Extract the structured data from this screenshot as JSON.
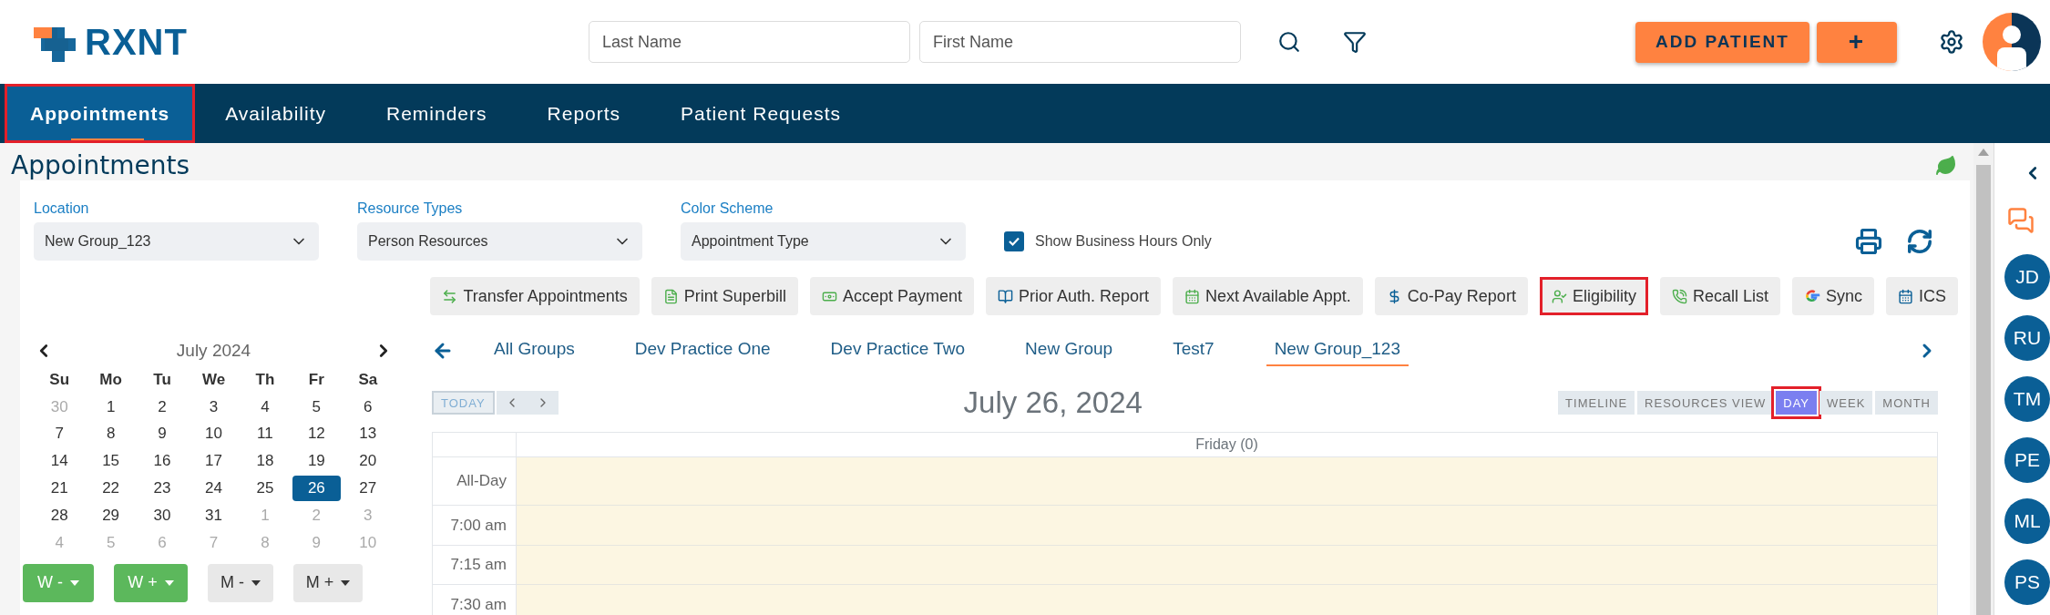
{
  "header": {
    "logo": "RXNT",
    "search_fields": [
      {
        "placeholder": "Last Name"
      },
      {
        "placeholder": "First Name"
      }
    ],
    "add_patient": "ADD PATIENT",
    "add_button": "+"
  },
  "nav": {
    "tabs": [
      {
        "label": "Appointments",
        "selected": true,
        "highlighted": true
      },
      {
        "label": "Availability",
        "selected": false,
        "highlighted": false
      },
      {
        "label": "Reminders",
        "selected": false,
        "highlighted": false
      },
      {
        "label": "Reports",
        "selected": false,
        "highlighted": false
      },
      {
        "label": "Patient Requests",
        "selected": false,
        "highlighted": false
      }
    ]
  },
  "page_title": "Appointments",
  "filters": [
    {
      "label": "Location",
      "value": "New Group_123"
    },
    {
      "label": "Resource Types",
      "value": "Person Resources"
    },
    {
      "label": "Color Scheme",
      "value": "Appointment Type"
    }
  ],
  "business_hours": {
    "label": "Show Business Hours Only",
    "checked": true
  },
  "actions": [
    {
      "kind": "transfer",
      "label": "Transfer Appointments",
      "highlighted": false
    },
    {
      "kind": "superbill",
      "label": "Print Superbill",
      "highlighted": false
    },
    {
      "kind": "payment",
      "label": "Accept Payment",
      "highlighted": false
    },
    {
      "kind": "auth",
      "label": "Prior Auth. Report",
      "highlighted": false
    },
    {
      "kind": "next",
      "label": "Next Available Appt.",
      "highlighted": false
    },
    {
      "kind": "copay",
      "label": "Co-Pay Report",
      "highlighted": false
    },
    {
      "kind": "eligibility",
      "label": "Eligibility",
      "highlighted": true
    },
    {
      "kind": "recall",
      "label": "Recall List",
      "highlighted": false
    },
    {
      "kind": "sync",
      "label": "Sync",
      "highlighted": false
    },
    {
      "kind": "ics",
      "label": "ICS",
      "highlighted": false
    }
  ],
  "mini_calendar": {
    "month": "July 2024",
    "weekdays": [
      "Su",
      "Mo",
      "Tu",
      "We",
      "Th",
      "Fr",
      "Sa"
    ],
    "weeks": [
      [
        {
          "day": "30",
          "outside": true,
          "selected": false
        },
        {
          "day": "1",
          "outside": false,
          "selected": false
        },
        {
          "day": "2",
          "outside": false,
          "selected": false
        },
        {
          "day": "3",
          "outside": false,
          "selected": false
        },
        {
          "day": "4",
          "outside": false,
          "selected": false
        },
        {
          "day": "5",
          "outside": false,
          "selected": false
        },
        {
          "day": "6",
          "outside": false,
          "selected": false
        }
      ],
      [
        {
          "day": "7",
          "outside": false,
          "selected": false
        },
        {
          "day": "8",
          "outside": false,
          "selected": false
        },
        {
          "day": "9",
          "outside": false,
          "selected": false
        },
        {
          "day": "10",
          "outside": false,
          "selected": false
        },
        {
          "day": "11",
          "outside": false,
          "selected": false
        },
        {
          "day": "12",
          "outside": false,
          "selected": false
        },
        {
          "day": "13",
          "outside": false,
          "selected": false
        }
      ],
      [
        {
          "day": "14",
          "outside": false,
          "selected": false
        },
        {
          "day": "15",
          "outside": false,
          "selected": false
        },
        {
          "day": "16",
          "outside": false,
          "selected": false
        },
        {
          "day": "17",
          "outside": false,
          "selected": false
        },
        {
          "day": "18",
          "outside": false,
          "selected": false
        },
        {
          "day": "19",
          "outside": false,
          "selected": false
        },
        {
          "day": "20",
          "outside": false,
          "selected": false
        }
      ],
      [
        {
          "day": "21",
          "outside": false,
          "selected": false
        },
        {
          "day": "22",
          "outside": false,
          "selected": false
        },
        {
          "day": "23",
          "outside": false,
          "selected": false
        },
        {
          "day": "24",
          "outside": false,
          "selected": false
        },
        {
          "day": "25",
          "outside": false,
          "selected": false
        },
        {
          "day": "26",
          "outside": false,
          "selected": true
        },
        {
          "day": "27",
          "outside": false,
          "selected": false
        }
      ],
      [
        {
          "day": "28",
          "outside": false,
          "selected": false
        },
        {
          "day": "29",
          "outside": false,
          "selected": false
        },
        {
          "day": "30",
          "outside": false,
          "selected": false
        },
        {
          "day": "31",
          "outside": false,
          "selected": false
        },
        {
          "day": "1",
          "outside": true,
          "selected": false
        },
        {
          "day": "2",
          "outside": true,
          "selected": false
        },
        {
          "day": "3",
          "outside": true,
          "selected": false
        }
      ],
      [
        {
          "day": "4",
          "outside": true,
          "selected": false
        },
        {
          "day": "5",
          "outside": true,
          "selected": false
        },
        {
          "day": "6",
          "outside": true,
          "selected": false
        },
        {
          "day": "7",
          "outside": true,
          "selected": false
        },
        {
          "day": "8",
          "outside": true,
          "selected": false
        },
        {
          "day": "9",
          "outside": true,
          "selected": false
        },
        {
          "day": "10",
          "outside": true,
          "selected": false
        }
      ]
    ]
  },
  "range_buttons": [
    {
      "label": "W -",
      "color": "#5cb85c"
    },
    {
      "label": "W +",
      "color": "#5cb85c"
    },
    {
      "label": "M -",
      "color": "#e8e8e8"
    },
    {
      "label": "M +",
      "color": "#e8e8e8"
    }
  ],
  "group_tabs": [
    {
      "label": "All Groups",
      "selected": false
    },
    {
      "label": "Dev Practice One",
      "selected": false
    },
    {
      "label": "Dev Practice Two",
      "selected": false
    },
    {
      "label": "New Group",
      "selected": false
    },
    {
      "label": "Test7",
      "selected": false
    },
    {
      "label": "New Group_123",
      "selected": true
    }
  ],
  "calendar": {
    "today": "TODAY",
    "title": "July 26, 2024",
    "views": [
      {
        "label": "TIMELINE",
        "selected": false,
        "highlighted": false
      },
      {
        "label": "RESOURCES VIEW",
        "selected": false,
        "highlighted": false
      },
      {
        "label": "DAY",
        "selected": true,
        "highlighted": true
      },
      {
        "label": "WEEK",
        "selected": false,
        "highlighted": false
      },
      {
        "label": "MONTH",
        "selected": false,
        "highlighted": false
      }
    ],
    "day_header": "Friday (0)",
    "rows": [
      "All-Day",
      "7:00 am",
      "7:15 am",
      "7:30 am"
    ]
  },
  "sidebar": {
    "initials": [
      "JD",
      "RU",
      "TM",
      "PE",
      "ML",
      "PS"
    ]
  }
}
